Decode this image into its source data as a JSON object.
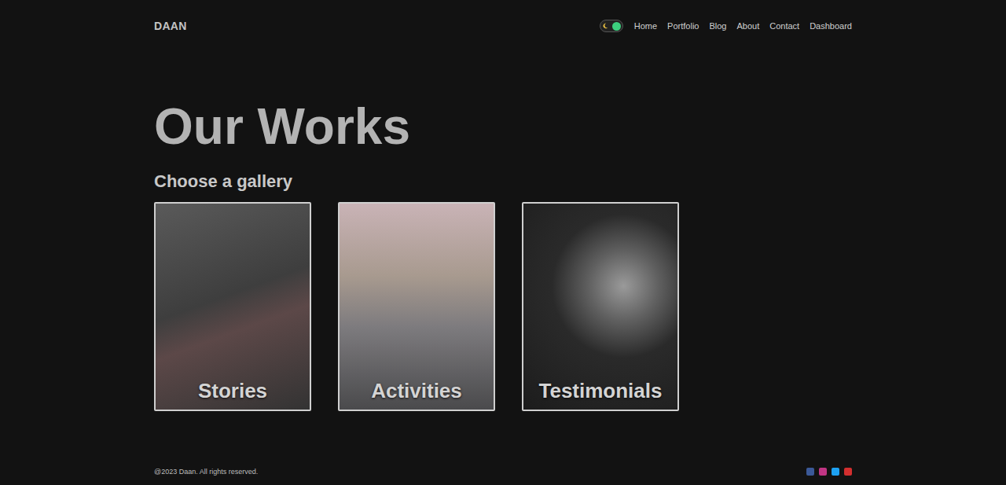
{
  "header": {
    "logo": "DAAN"
  },
  "theme_toggle": {
    "on": true
  },
  "nav": [
    {
      "label": "Home"
    },
    {
      "label": "Portfolio"
    },
    {
      "label": "Blog"
    },
    {
      "label": "About"
    },
    {
      "label": "Contact"
    },
    {
      "label": "Dashboard"
    }
  ],
  "title": "Our Works",
  "subtitle": "Choose a gallery",
  "galleries": [
    {
      "label": "Stories"
    },
    {
      "label": "Activities"
    },
    {
      "label": "Testimonials"
    }
  ],
  "footer": {
    "copyright": "@2023 Daan. All rights reserved.",
    "social": [
      {
        "name": "facebook",
        "color": "#3b5998"
      },
      {
        "name": "instagram",
        "color": "#c13584"
      },
      {
        "name": "twitter",
        "color": "#1da1f2"
      },
      {
        "name": "youtube",
        "color": "#d32f2f"
      }
    ]
  }
}
